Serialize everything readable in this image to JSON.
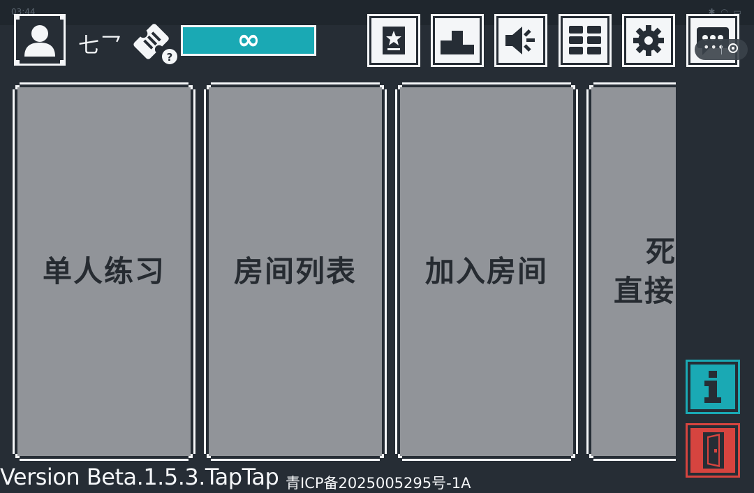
{
  "status_bar": {
    "time": "03:44",
    "icons": "✱ ◠ ▭"
  },
  "profile": {
    "username": "七乛"
  },
  "tickets": {
    "count": "∞",
    "help_badge": "?"
  },
  "toolbar": [
    {
      "name": "achievements-icon"
    },
    {
      "name": "leaderboard-icon"
    },
    {
      "name": "announcement-icon"
    },
    {
      "name": "menu-grid-icon"
    },
    {
      "name": "settings-gear-icon"
    },
    {
      "name": "more-chat-icon"
    }
  ],
  "mini_program": {
    "dots": "•••"
  },
  "modes": [
    {
      "label": "单人练习"
    },
    {
      "label": "房间列表"
    },
    {
      "label": "加入房间"
    },
    {
      "label_line1": "死",
      "label_line2": "直接"
    }
  ],
  "footer": {
    "version": "Version Beta.1.5.3.TapTap",
    "icp": "青ICP备2025005295号-1A"
  },
  "colors": {
    "background": "#262d35",
    "card_face": "#919499",
    "accent_teal": "#1aa9b4",
    "exit_red": "#d6443f",
    "border_white": "#f4f6f8"
  }
}
